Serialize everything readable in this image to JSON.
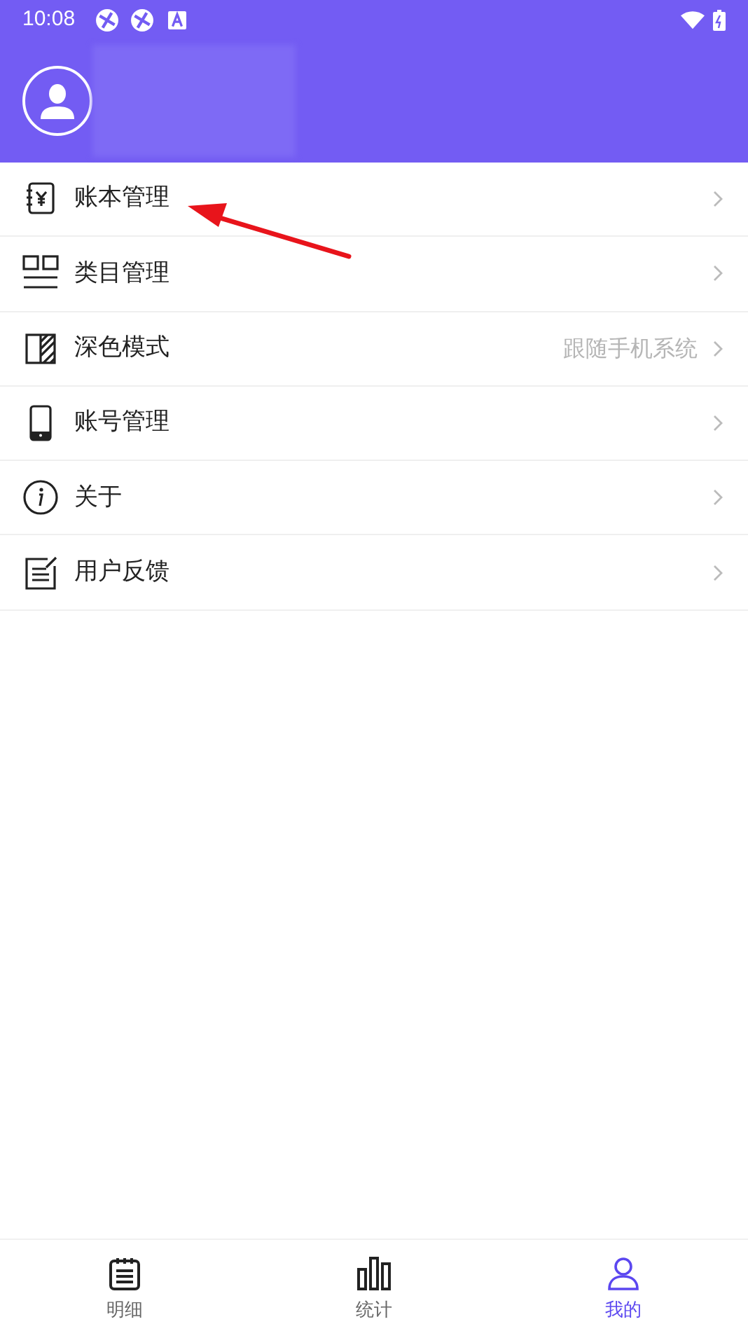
{
  "status_bar": {
    "time": "10:08"
  },
  "menu": [
    {
      "kind": "ledger",
      "label": "账本管理"
    },
    {
      "kind": "category",
      "label": "类目管理"
    },
    {
      "kind": "dark",
      "label": "深色模式",
      "value": "跟随手机系统"
    },
    {
      "kind": "phone",
      "label": "账号管理"
    },
    {
      "kind": "info",
      "label": "关于"
    },
    {
      "kind": "feedback",
      "label": "用户反馈"
    }
  ],
  "tabs": [
    {
      "kind": "detail",
      "label": "明细",
      "selected": false
    },
    {
      "kind": "stats",
      "label": "统计",
      "selected": false
    },
    {
      "kind": "me",
      "label": "我的",
      "selected": true
    }
  ]
}
